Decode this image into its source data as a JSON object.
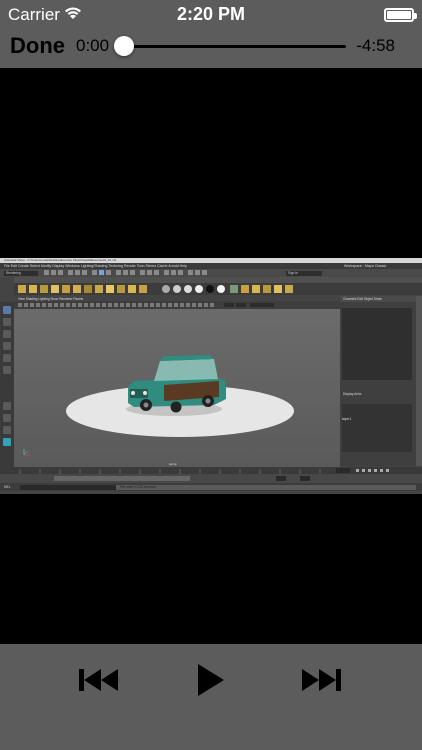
{
  "status_bar": {
    "carrier": "Carrier",
    "time": "2:20 PM",
    "battery_level": 1.0
  },
  "player": {
    "done_label": "Done",
    "elapsed": "0:00",
    "remaining": "-4:58",
    "progress": 0.0
  },
  "video": {
    "maya": {
      "title": "Autodesk Maya - C:\\Users\\Lynda\\Desktop\\Exercise Files\\Chap02\\Exercise02_01.mb",
      "menus": "File  Edit  Create  Select  Modify  Display  Windows  Lighting/Shading  Texturing  Render  Toon  Stereo  Cache  Arnold  Help",
      "workspace": "Workspace : Maya Classic",
      "mode": "Rendering",
      "signin": "Sign In",
      "shelf_tabs": [
        "Curves / Surfaces",
        "Polygons",
        "Sculpting",
        "Rigging",
        "Animation",
        "Rendering",
        "FX",
        "FX Caching",
        "Custom",
        "Arnold",
        "Bifrost",
        "MASH",
        "Motion Graphics",
        "XGen"
      ],
      "active_shelf": "Rendering",
      "panel_menus": "View  Shading  Lighting  Show  Renderer  Panels",
      "camera_label": "persp",
      "right_tabs": "Channels  Edit  Object  Show",
      "display_tabs": "Display  Anim",
      "layer_name": "layer1",
      "mel_label": "MEL",
      "status_message": "File read in 0.33 seconds."
    }
  },
  "controls": {
    "prev_icon": "skip-back-icon",
    "play_icon": "play-icon",
    "next_icon": "skip-forward-icon"
  },
  "colors": {
    "bar_background": "#5c5c5c",
    "video_background": "#000000",
    "car_body": "#2f8c7e",
    "car_wood": "#5a3a22"
  }
}
